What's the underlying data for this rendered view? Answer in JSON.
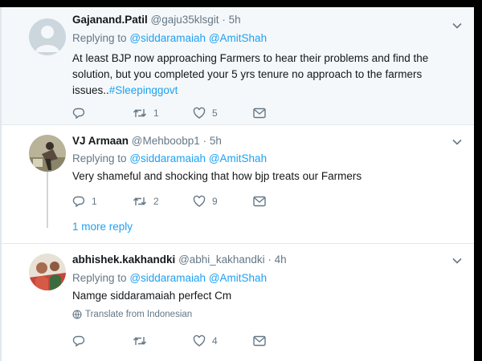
{
  "tweets": [
    {
      "name": "Gajanand.Patil",
      "handle": "@gaju35klsgit",
      "time": "5h",
      "replying_label": "Replying to",
      "mentions": [
        "@siddaramaiah",
        "@AmitShah"
      ],
      "text": "At least BJP now approaching Farmers to hear their problems and find the solution, but you completed your 5 yrs tenure no approach to the farmers issues..",
      "hashtag": "#Sleepinggovt",
      "replies": "",
      "retweets": "1",
      "likes": "5"
    },
    {
      "name": "VJ Armaan",
      "handle": "@Mehboobp1",
      "time": "5h",
      "replying_label": "Replying to",
      "mentions": [
        "@siddaramaiah",
        "@AmitShah"
      ],
      "text": "Very shameful and shocking that how bjp treats our Farmers",
      "replies": "1",
      "retweets": "2",
      "likes": "9",
      "more_replies": "1 more reply"
    },
    {
      "name": "abhishek.kakhandki",
      "handle": "@abhi_kakhandki",
      "time": "4h",
      "replying_label": "Replying to",
      "mentions": [
        "@siddaramaiah",
        "@AmitShah"
      ],
      "text": "Namge siddaramaiah perfect Cm",
      "translate": "Translate from Indonesian",
      "replies": "",
      "retweets": "",
      "likes": "4"
    }
  ],
  "colors": {
    "accent": "#1da1f2",
    "secondary_text": "#657786",
    "highlight_bg": "#f5f8fa"
  },
  "icons": [
    "caret-down-icon",
    "reply-icon",
    "retweet-icon",
    "like-icon",
    "dm-icon",
    "globe-icon"
  ]
}
